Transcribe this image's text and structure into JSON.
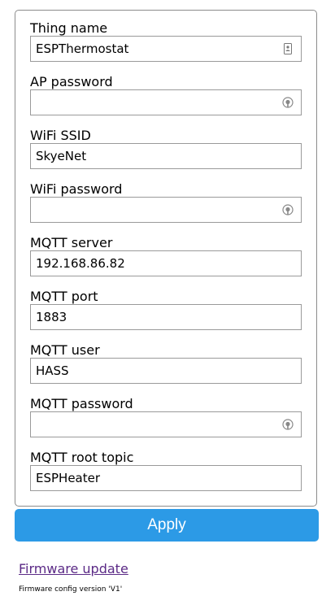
{
  "form": {
    "fields": [
      {
        "label": "Thing name",
        "value": "ESPThermostat",
        "type": "text",
        "icon": "contact-card-icon"
      },
      {
        "label": "AP password",
        "value": "",
        "type": "password",
        "icon": "password-reveal-icon"
      },
      {
        "label": "WiFi SSID",
        "value": "SkyeNet",
        "type": "text",
        "icon": ""
      },
      {
        "label": "WiFi password",
        "value": "",
        "type": "password",
        "icon": "password-reveal-icon"
      },
      {
        "label": "MQTT server",
        "value": "192.168.86.82",
        "type": "text",
        "icon": ""
      },
      {
        "label": "MQTT port",
        "value": "1883",
        "type": "text",
        "icon": ""
      },
      {
        "label": "MQTT user",
        "value": "HASS",
        "type": "text",
        "icon": ""
      },
      {
        "label": "MQTT password",
        "value": "",
        "type": "password",
        "icon": "password-reveal-icon"
      },
      {
        "label": "MQTT root topic",
        "value": "ESPHeater",
        "type": "text",
        "icon": ""
      }
    ],
    "apply_label": "Apply"
  },
  "footer": {
    "firmware_update_link": "Firmware update",
    "firmware_version_text": "Firmware config version 'V1'"
  },
  "colors": {
    "button_bg": "#2c9ae6",
    "button_text": "#ffffff",
    "link": "#5b2a86",
    "border": "#9a9a9a"
  }
}
